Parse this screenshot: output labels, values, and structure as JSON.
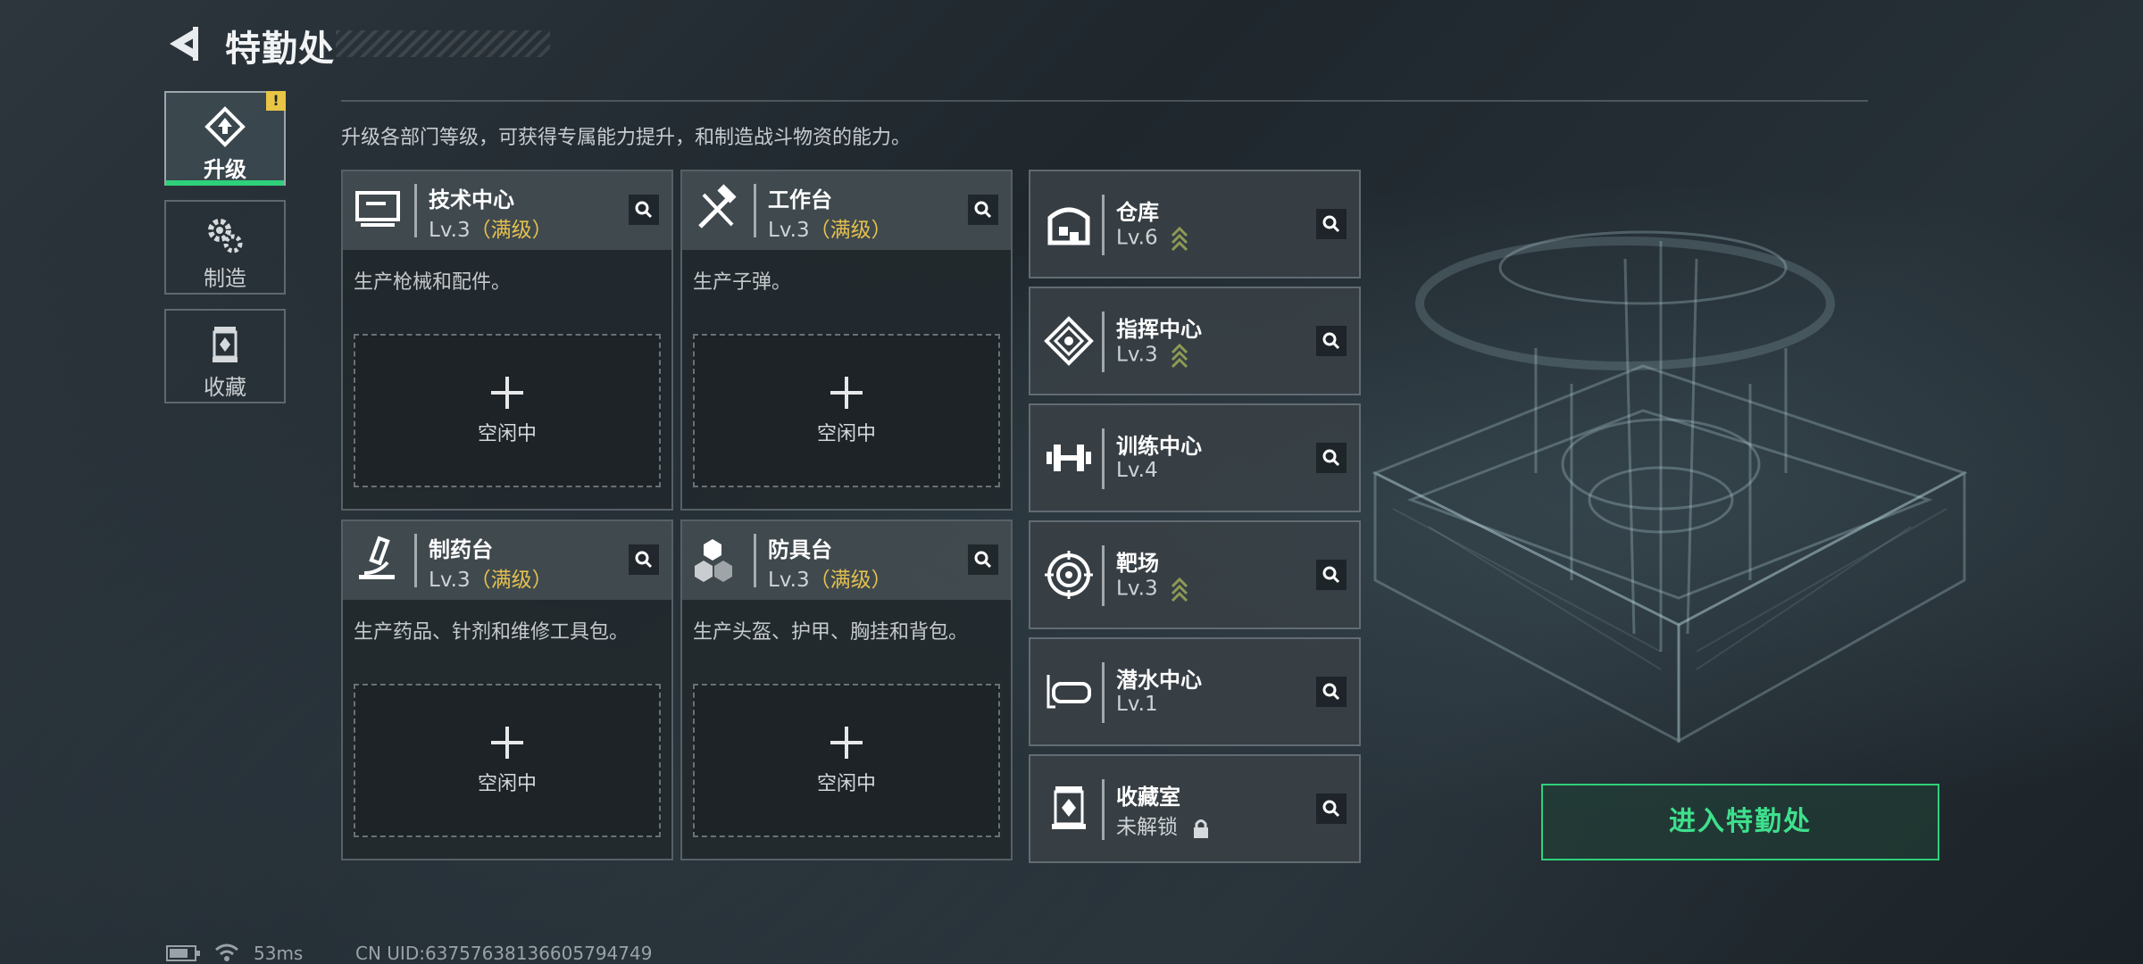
{
  "header": {
    "title": "特勤处"
  },
  "sidebar": {
    "tabs": [
      {
        "label": "升级",
        "icon": "upgrade-icon",
        "active": true,
        "alert": "!"
      },
      {
        "label": "制造",
        "icon": "gears-icon",
        "active": false
      },
      {
        "label": "收藏",
        "icon": "collection-icon",
        "active": false
      }
    ]
  },
  "description": "升级各部门等级，可获得专属能力提升，和制造战斗物资的能力。",
  "workstations": [
    {
      "name": "技术中心",
      "level": "Lv.3",
      "max_label": "（满级）",
      "desc": "生产枪械和配件。",
      "slot": "空闲中",
      "icon": "computer-icon"
    },
    {
      "name": "工作台",
      "level": "Lv.3",
      "max_label": "（满级）",
      "desc": "生产子弹。",
      "slot": "空闲中",
      "icon": "tools-icon"
    },
    {
      "name": "制药台",
      "level": "Lv.3",
      "max_label": "（满级）",
      "desc": "生产药品、针剂和维修工具包。",
      "slot": "空闲中",
      "icon": "microscope-icon"
    },
    {
      "name": "防具台",
      "level": "Lv.3",
      "max_label": "（满级）",
      "desc": "生产头盔、护甲、胸挂和背包。",
      "slot": "空闲中",
      "icon": "armor-icon"
    }
  ],
  "departments": [
    {
      "name": "仓库",
      "level": "Lv.6",
      "upgradable": true,
      "icon": "warehouse-icon"
    },
    {
      "name": "指挥中心",
      "level": "Lv.3",
      "upgradable": true,
      "icon": "command-icon"
    },
    {
      "name": "训练中心",
      "level": "Lv.4",
      "upgradable": false,
      "icon": "dumbbell-icon"
    },
    {
      "name": "靶场",
      "level": "Lv.3",
      "upgradable": true,
      "icon": "target-icon"
    },
    {
      "name": "潜水中心",
      "level": "Lv.1",
      "upgradable": false,
      "icon": "diving-mask-icon"
    },
    {
      "name": "收藏室",
      "level": "未解锁",
      "upgradable": false,
      "locked": true,
      "icon": "collection-room-icon"
    }
  ],
  "enter_button": "进入特勤处",
  "status_bar": {
    "ping": "53ms",
    "uid": "CN UID:6375763813660579474​9"
  },
  "colors": {
    "accent_green": "#2fd07a",
    "max_gold": "#e4c04d"
  }
}
